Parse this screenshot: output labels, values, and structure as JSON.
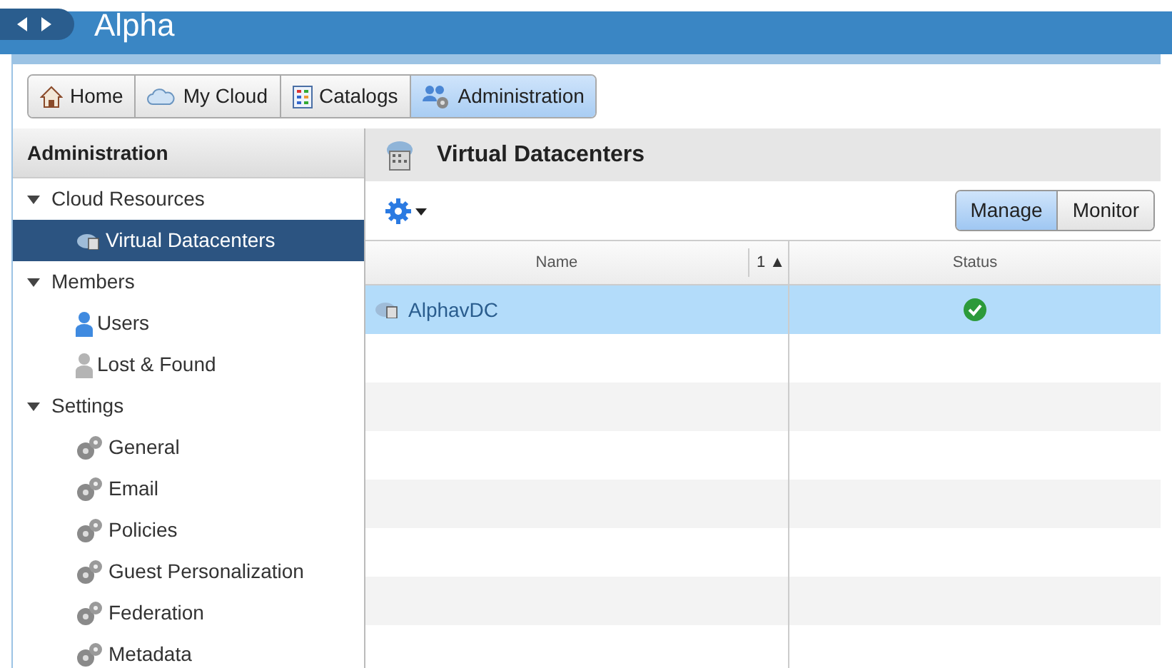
{
  "window": {
    "title": "Alpha"
  },
  "nav_tabs": [
    {
      "label": "Home",
      "kind": "home",
      "selected": false
    },
    {
      "label": "My Cloud",
      "kind": "cloud",
      "selected": false
    },
    {
      "label": "Catalogs",
      "kind": "catalog",
      "selected": false
    },
    {
      "label": "Administration",
      "kind": "admin",
      "selected": true
    }
  ],
  "sidebar": {
    "title": "Administration",
    "items": [
      {
        "label": "Cloud Resources",
        "expanded": true,
        "children": [
          {
            "label": "Virtual Datacenters",
            "kind": "datacenter",
            "selected": true
          }
        ]
      },
      {
        "label": "Members",
        "expanded": true,
        "children": [
          {
            "label": "Users",
            "kind": "user",
            "selected": false
          },
          {
            "label": "Lost & Found",
            "kind": "lost_user",
            "selected": false
          }
        ]
      },
      {
        "label": "Settings",
        "expanded": true,
        "children": [
          {
            "label": "General",
            "kind": "settings",
            "selected": false
          },
          {
            "label": "Email",
            "kind": "settings",
            "selected": false
          },
          {
            "label": "Policies",
            "kind": "settings",
            "selected": false
          },
          {
            "label": "Guest Personalization",
            "kind": "settings",
            "selected": false
          },
          {
            "label": "Federation",
            "kind": "settings",
            "selected": false
          },
          {
            "label": "Metadata",
            "kind": "settings",
            "selected": false
          }
        ]
      }
    ]
  },
  "panel": {
    "title": "Virtual Datacenters",
    "view_toggle": [
      {
        "label": "Manage",
        "selected": true
      },
      {
        "label": "Monitor",
        "selected": false
      }
    ],
    "table": {
      "columns": [
        {
          "label": "Name",
          "sort": "1 ▲"
        },
        {
          "label": "Status"
        }
      ],
      "rows": [
        {
          "name": "AlphavDC",
          "selected": true
        }
      ]
    }
  }
}
